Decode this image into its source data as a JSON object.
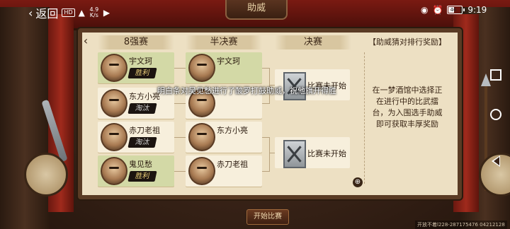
{
  "title_plaque": "助威",
  "status": {
    "back_label": "返回",
    "hd_badge": "HD",
    "net_speed_value": "4.9",
    "net_speed_unit": "K/s",
    "battery_text": "46",
    "battery_level": 0.46,
    "time": "9:19"
  },
  "bracket": {
    "headers": [
      "8强赛",
      "半决赛",
      "决赛"
    ],
    "round1": [
      {
        "name": "宇文珂",
        "result": "胜利",
        "winner": true
      },
      {
        "name": "东方小亮",
        "result": "淘汰",
        "winner": false
      },
      {
        "name": "赤刀老祖",
        "result": "淘汰",
        "winner": false
      },
      {
        "name": "鬼见愁",
        "result": "胜利",
        "winner": true
      }
    ],
    "round2": [
      {
        "name": "宇文珂"
      },
      {
        "name": ""
      },
      {
        "name": "东方小亮"
      },
      {
        "name": "赤刀老祖"
      }
    ],
    "finals": [
      {
        "status": "比赛未开始"
      },
      {
        "status": "比赛未开始"
      }
    ]
  },
  "reward": {
    "title": "【助威猜对排行奖励】",
    "description": "在一梦酒馆中选择正在进行中的比武擂台，为入围选手助威即可获取丰厚奖励"
  },
  "bulletin": "明白条对吴见愁进行了酸罗打鼓助威，祝他旗开得胜",
  "start_button": "开始比赛",
  "watermark": "开放不着l228-287175476 04212128"
}
